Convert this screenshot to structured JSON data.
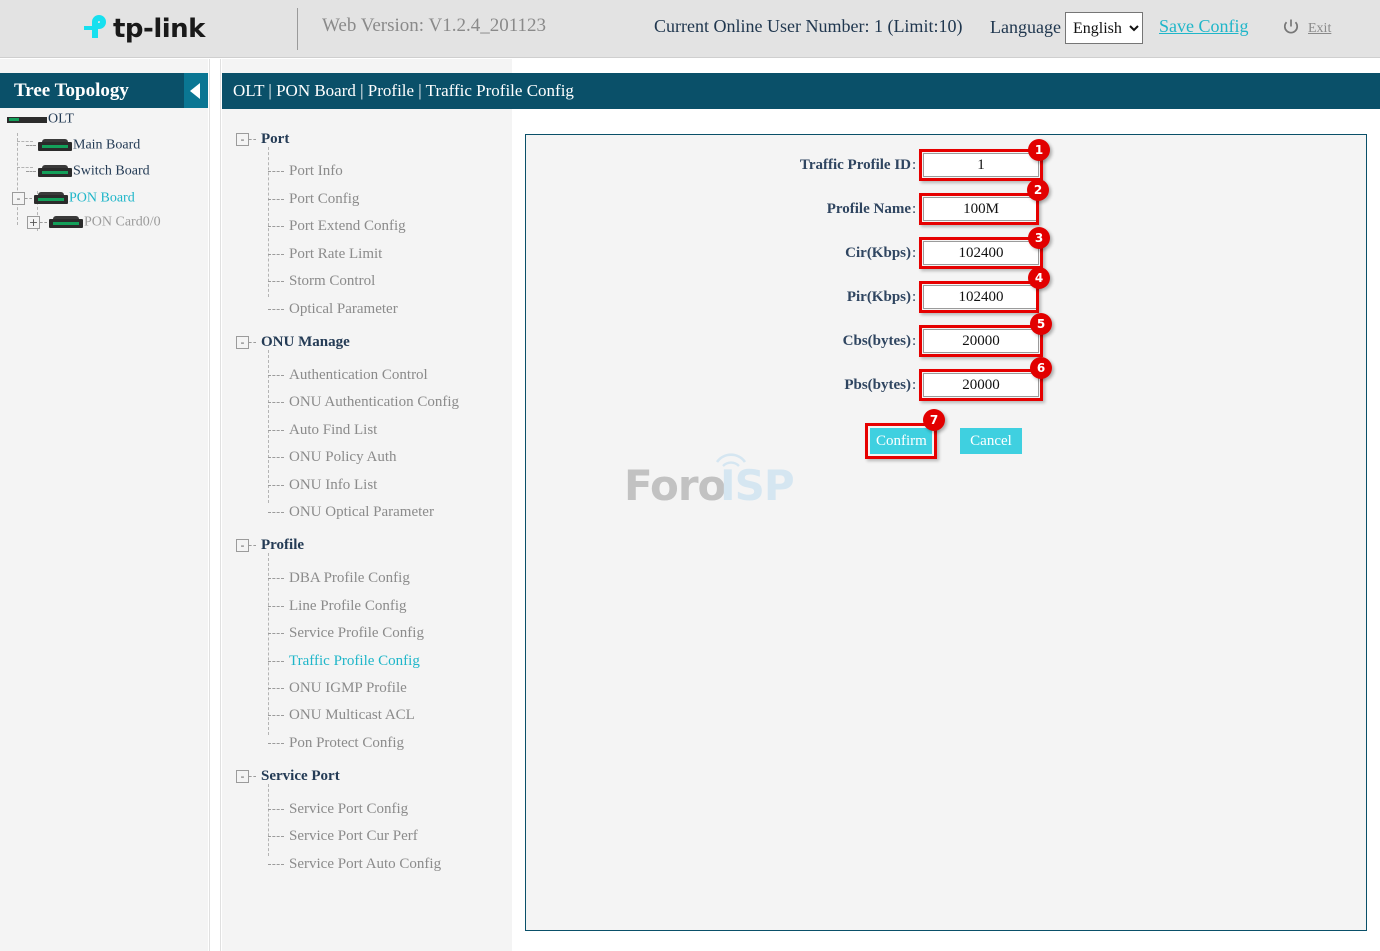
{
  "header": {
    "logo_text": "tp-link",
    "logo_icon": "tp-link-logo-icon",
    "web_version": "Web Version: V1.2.4_201123",
    "online_users": "Current Online User Number: 1 (Limit:10)",
    "language_label": "Language",
    "language_selected": "English",
    "language_options": [
      "English"
    ],
    "save_config": "Save Config",
    "exit": "Exit",
    "power_icon": "power-icon"
  },
  "tree": {
    "title": "Tree Topology",
    "collapse_icon": "chevron-left-icon",
    "nodes": [
      {
        "label": "OLT",
        "type": "olt",
        "expander": null,
        "active": false
      },
      {
        "label": "Main Board",
        "type": "board",
        "expander": null,
        "active": false
      },
      {
        "label": "Switch Board",
        "type": "board",
        "expander": null,
        "active": false
      },
      {
        "label": "PON Board",
        "type": "board",
        "expander": "-",
        "active": true
      },
      {
        "label": "PON Card0/0",
        "type": "board",
        "expander": "+",
        "active": false
      }
    ]
  },
  "menu": {
    "groups": [
      {
        "label": "Port",
        "expander": "-",
        "items": [
          "Port Info",
          "Port Config",
          "Port Extend Config",
          "Port Rate Limit",
          "Storm Control",
          "Optical Parameter"
        ]
      },
      {
        "label": "ONU Manage",
        "expander": "-",
        "items": [
          "Authentication Control",
          "ONU Authentication Config",
          "Auto Find List",
          "ONU Policy Auth",
          "ONU Info List",
          "ONU Optical Parameter"
        ]
      },
      {
        "label": "Profile",
        "expander": "-",
        "items": [
          "DBA Profile Config",
          "Line Profile Config",
          "Service Profile Config",
          "Traffic Profile Config",
          "ONU IGMP Profile",
          "ONU Multicast ACL",
          "Pon Protect Config"
        ]
      },
      {
        "label": "Service Port",
        "expander": "-",
        "items": [
          "Service Port Config",
          "Service Port Cur Perf",
          "Service Port Auto Config"
        ]
      }
    ],
    "active_item": "Traffic Profile Config"
  },
  "breadcrumb": "OLT | PON Board | Profile | Traffic Profile Config",
  "watermark": {
    "part1": "Foro",
    "part2": "ISP",
    "arc_icon": "signal-arc-icon"
  },
  "form": {
    "fields": [
      {
        "label": "Traffic Profile ID",
        "colon": ":",
        "value": "1",
        "badge": "1"
      },
      {
        "label": "Profile Name",
        "colon": ":",
        "value": "100M",
        "badge": "2"
      },
      {
        "label": "Cir(Kbps)",
        "colon": ":",
        "value": "102400",
        "badge": "3"
      },
      {
        "label": "Pir(Kbps)",
        "colon": ":",
        "value": "102400",
        "badge": "4"
      },
      {
        "label": "Cbs(bytes)",
        "colon": ":",
        "value": "20000",
        "badge": "5"
      },
      {
        "label": "Pbs(bytes)",
        "colon": ":",
        "value": "20000",
        "badge": "6"
      }
    ],
    "confirm_label": "Confirm",
    "cancel_label": "Cancel",
    "confirm_badge": "7"
  },
  "colors": {
    "header_bg": "#e3e3e3",
    "teal_dark": "#0a5069",
    "teal_light": "#0a7693",
    "cyan_accent": "#1fb6c9",
    "button_cyan": "#3fd0e0",
    "annotation_red": "#e20000",
    "panel_bg": "#f4f4f4",
    "label_text": "#2f4560",
    "menu_text": "#8b8b8b"
  }
}
